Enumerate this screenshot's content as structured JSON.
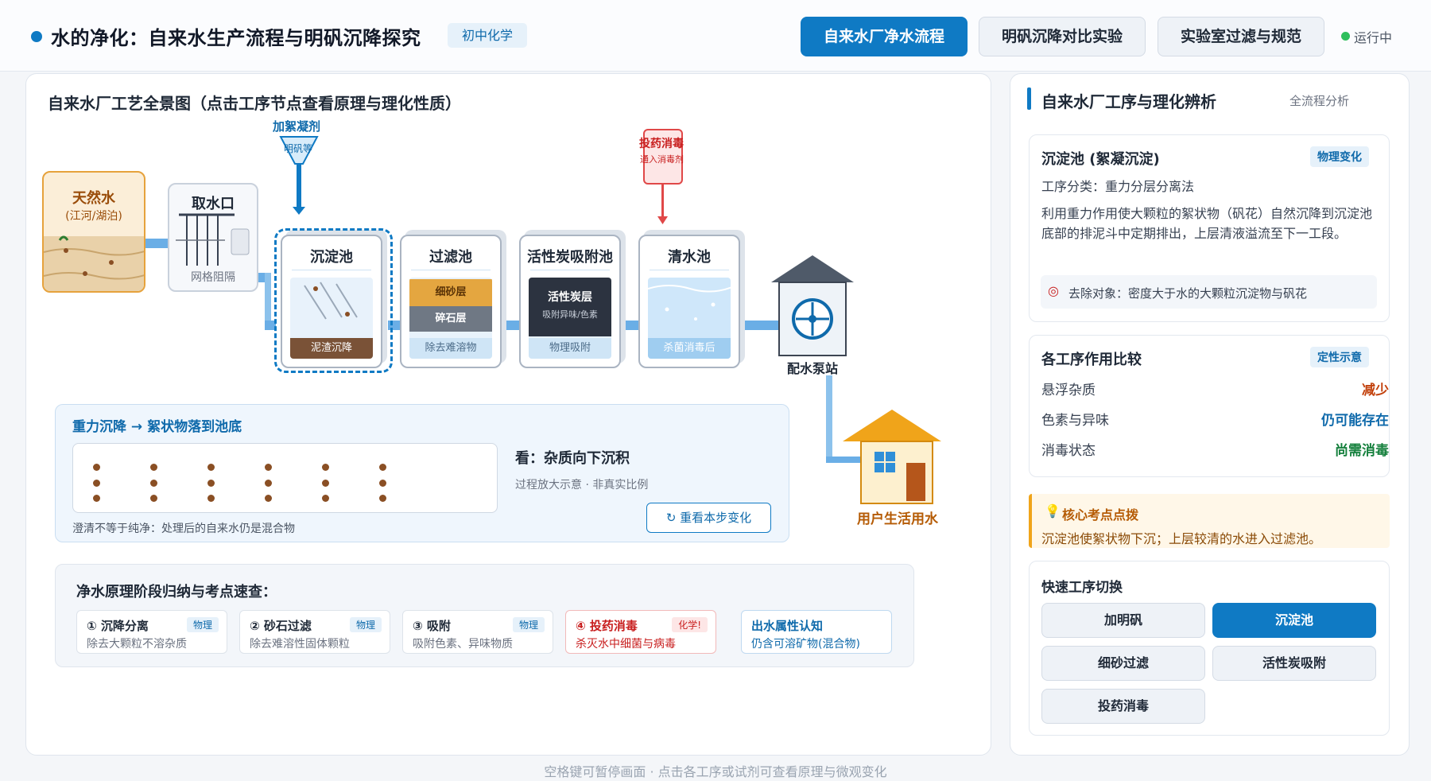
{
  "header": {
    "title": "水的净化：自来水生产流程与明矾沉降探究",
    "grade": "初中化学",
    "tabs": [
      {
        "label": "自来水厂净水流程",
        "active": true
      },
      {
        "label": "明矾沉降对比实验",
        "active": false
      },
      {
        "label": "实验室过滤与规范",
        "active": false
      }
    ],
    "status": "运行中"
  },
  "diagram": {
    "title": "自来水厂工艺全景图（点击工序节点查看原理与理化性质）",
    "source": {
      "title": "天然水",
      "sub": "(江河/湖泊)"
    },
    "intake": {
      "title": "取水口",
      "sub": "网格阻隔"
    },
    "coagulant": {
      "label": "加絮凝剂",
      "sub": "明矾等"
    },
    "disinfectant": {
      "label": "投药消毒",
      "sub": "通入消毒剂"
    },
    "tanks": [
      {
        "title": "沉淀池",
        "caption": "泥渣沉降"
      },
      {
        "title": "过滤池",
        "caption": "除去难溶物",
        "layers": [
          "细砂层",
          "碎石层"
        ]
      },
      {
        "title": "活性炭吸附池",
        "caption": "物理吸附",
        "inner_title": "活性炭层",
        "inner_sub": "吸附异味/色素"
      },
      {
        "title": "清水池",
        "caption": "杀菌消毒后"
      }
    ],
    "pump": "配水泵站",
    "house": "用户生活用水"
  },
  "micro": {
    "title": "重力沉降 → 絮状物落到池底",
    "look": "看：杂质向下沉积",
    "scale": "过程放大示意 · 非真实比例",
    "note": "澄清不等于纯净：处理后的自来水仍是混合物",
    "replay": "重看本步变化"
  },
  "summary": {
    "title": "净水原理阶段归纳与考点速查：",
    "cards": [
      {
        "title": "① 沉降分离",
        "tag": "物理",
        "desc": "除去大颗粒不溶杂质"
      },
      {
        "title": "② 砂石过滤",
        "tag": "物理",
        "desc": "除去难溶性固体颗粒"
      },
      {
        "title": "③ 吸附",
        "tag": "物理",
        "desc": "吸附色素、异味物质"
      },
      {
        "title": "④ 投药消毒",
        "tag": "化学!",
        "desc": "杀灭水中细菌与病毒"
      },
      {
        "title": "出水属性认知",
        "tag": "",
        "desc": "仍含可溶矿物(混合物)"
      }
    ]
  },
  "footer": "空格键可暂停画面 · 点击各工序或试剂可查看原理与微观变化",
  "side": {
    "title": "自来水厂工序与理化辨析",
    "hint": "全流程分析",
    "detail": {
      "title": "沉淀池 (絮凝沉淀)",
      "tag": "物理变化",
      "category": "工序分类：重力分层分离法",
      "desc": "利用重力作用使大颗粒的絮状物（矾花）自然沉降到沉淀池底部的排泥斗中定期排出，上层清液溢流至下一工段。",
      "target": "去除对象：密度大于水的大颗粒沉淀物与矾花"
    },
    "compare": {
      "title": "各工序作用比较",
      "tag": "定性示意",
      "rows": [
        {
          "label": "悬浮杂质",
          "value": "减少",
          "color": "#c2410c"
        },
        {
          "label": "色素与异味",
          "value": "仍可能存在",
          "color": "#0f6aab"
        },
        {
          "label": "消毒状态",
          "value": "尚需消毒",
          "color": "#15803d"
        }
      ]
    },
    "tip": {
      "title": "核心考点点拨",
      "text": "沉淀池使絮状物下沉；上层较清的水进入过滤池。"
    },
    "quick": {
      "title": "快速工序切换",
      "buttons": [
        {
          "label": "加明矾",
          "active": false
        },
        {
          "label": "沉淀池",
          "active": true
        },
        {
          "label": "细砂过滤",
          "active": false
        },
        {
          "label": "活性炭吸附",
          "active": false
        },
        {
          "label": "投药消毒",
          "active": false
        }
      ]
    }
  }
}
